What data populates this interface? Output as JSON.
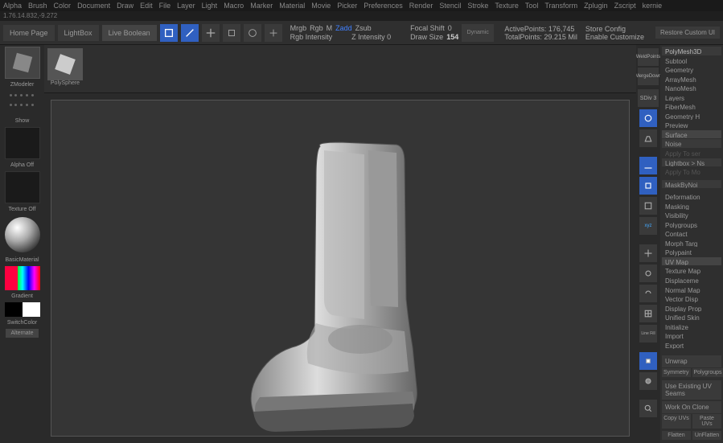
{
  "menu": [
    "Alpha",
    "Brush",
    "Color",
    "Document",
    "Draw",
    "Edit",
    "File",
    "Layer",
    "Light",
    "Macro",
    "Marker",
    "Material",
    "Movie",
    "Picker",
    "Preferences",
    "Render",
    "Stencil",
    "Stroke",
    "Texture",
    "Tool",
    "Transform",
    "Zplugin",
    "Zscript",
    "kernie"
  ],
  "coords": "1.76.14.832,-9.272",
  "tabs": {
    "home": "Home Page",
    "lightbox": "LightBox",
    "live": "Live Boolean"
  },
  "sliders": {
    "row1": {
      "mrgb": "Mrgb",
      "rgb": "Rgb",
      "m": "M",
      "zadd": "Zadd",
      "zsub": "Zsub"
    },
    "row2": {
      "rgbint": "Rgb Intensity",
      "zint": "Z Intensity 0"
    },
    "focal": {
      "label": "Focal Shift",
      "val": "0"
    },
    "draw": {
      "label": "Draw Size",
      "val": "154"
    }
  },
  "info": {
    "active": {
      "label": "ActivePoints:",
      "val": "176,745"
    },
    "total": {
      "label": "TotalPoints:",
      "val": "29.215 Mil"
    },
    "store": "Store Config",
    "enable": "Enable Customize",
    "restore": "Restore Custom UI"
  },
  "left": {
    "zmodeler": "ZModeler",
    "show": "Show",
    "alpha": "Alpha Off",
    "texture": "Texture Off",
    "material": "BasicMaterial",
    "gradient": "Gradient",
    "switch": "SwitchColor",
    "alt": "Alternate"
  },
  "shelf": {
    "polysphere": "PolySphere"
  },
  "subtool": {
    "weld": "WeldPoints",
    "merge": "MergeDown",
    "sdiv": "SDiv 3"
  },
  "rightTop": {
    "title": "PolyMesh3D"
  },
  "rightMenu": [
    "Subtool",
    "Geometry",
    "ArrayMesh",
    "NanoMesh",
    "Layers",
    "FiberMesh",
    "Geometry H",
    "Preview",
    "Surface",
    "Noise"
  ],
  "rightMenuB": [
    "Apply To ser",
    "Lightbox > Ns"
  ],
  "rightMenuC": [
    "Apply To Mo"
  ],
  "rightMenuD": [
    "MaskByNoi"
  ],
  "rightMenu2": [
    "Deformation",
    "Masking",
    "Visibility",
    "Polygroups",
    "Contact",
    "Morph Targ",
    "Polypaint",
    "UV Map",
    "Texture Map",
    "Displaceme",
    "Normal Map",
    "Vector Disp",
    "Display Prop",
    "Unified Skin",
    "Initialize",
    "Import",
    "Export"
  ],
  "uvSection": {
    "unwrap": "Unwrap",
    "symmetry": "Symmetry",
    "polygroups": "Polygroups",
    "useexisting": "Use Existing UV Seams",
    "workclone": "Work On Clone",
    "copyuv": "Copy UVs",
    "pasteuv": "Paste UVs",
    "flatten": "Flatten",
    "unflatten": "UnFlatten"
  }
}
